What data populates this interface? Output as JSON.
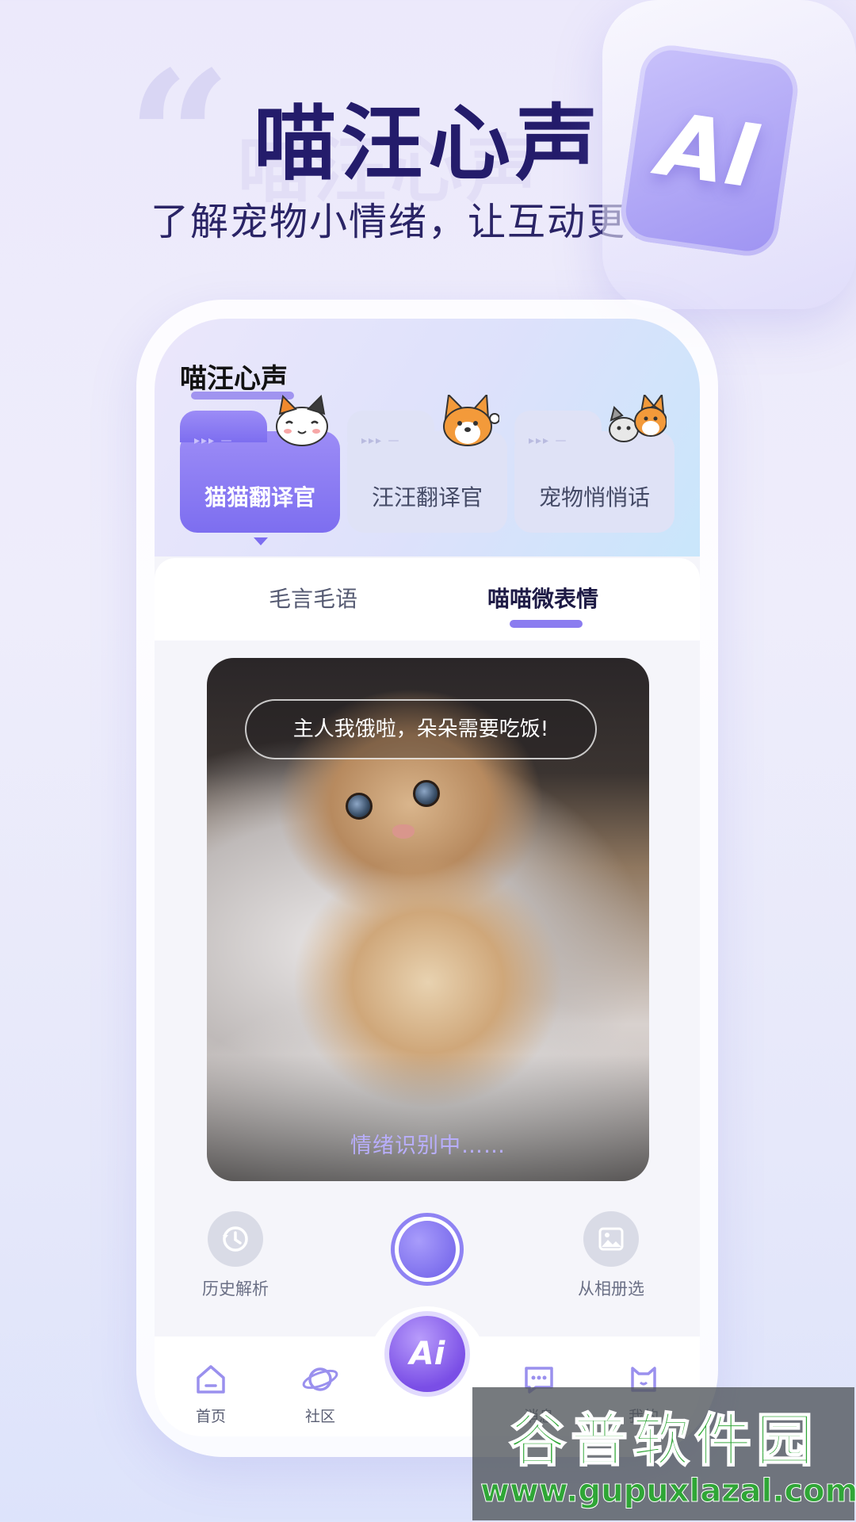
{
  "promo": {
    "quote_mark": "“",
    "title": "喵汪心声",
    "ghost_title": "喵汪心声",
    "subtitle": "了解宠物小情绪，让互动更有爱",
    "badge_text": "AI"
  },
  "app": {
    "title": "喵汪心声",
    "modes": [
      {
        "label": "猫猫翻译官",
        "active": true,
        "icon": "calico-cat-icon"
      },
      {
        "label": "汪汪翻译官",
        "active": false,
        "icon": "corgi-dog-icon"
      },
      {
        "label": "宠物悄悄话",
        "active": false,
        "icon": "cat-and-dog-icon"
      }
    ],
    "mode_dots": "▸▸▸ —",
    "subtabs": [
      {
        "label": "毛言毛语",
        "active": false
      },
      {
        "label": "喵喵微表情",
        "active": true
      }
    ],
    "photo": {
      "bubble_text": "主人我饿啦，朵朵需要吃饭!",
      "status_text": "情绪识别中……"
    },
    "actions": {
      "history_label": "历史解析",
      "album_label": "从相册选"
    },
    "nav": {
      "home": "首页",
      "community": "社区",
      "ai": "Ai",
      "messages": "消息",
      "mine": "我的"
    }
  },
  "watermark": {
    "name": "谷普软件园",
    "url": "www.gupuxlazal.com"
  },
  "colors": {
    "accent": "#7d6ef0",
    "title": "#241c6b",
    "status": "#b8aefb"
  }
}
